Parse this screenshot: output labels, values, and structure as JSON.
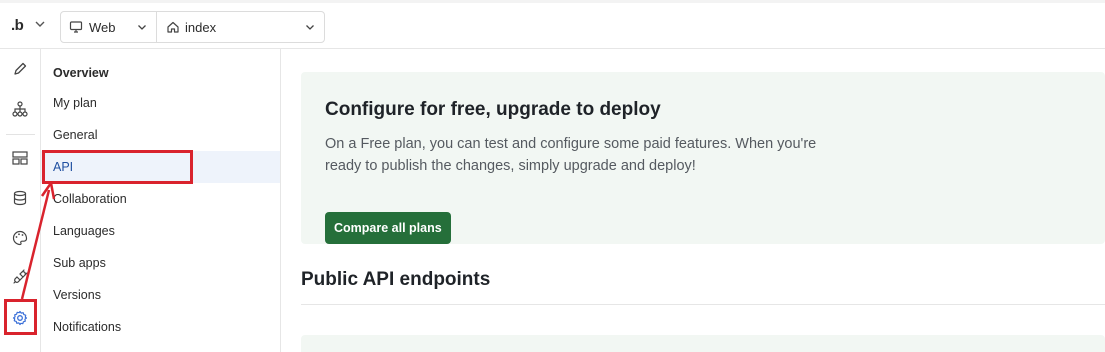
{
  "topbar": {
    "logo": ".b",
    "platform_select": {
      "value": "Web",
      "icon": "monitor-icon"
    },
    "page_select": {
      "value": "index",
      "icon": "home-icon"
    }
  },
  "rail": {
    "icons": [
      "pencil-icon",
      "workflow-icon",
      "layout-icon",
      "database-icon",
      "palette-icon",
      "plug-icon",
      "gear-icon"
    ],
    "active": "gear-icon"
  },
  "nav": {
    "items": [
      {
        "label": "Overview"
      },
      {
        "label": "My plan"
      },
      {
        "label": "General"
      },
      {
        "label": "API"
      },
      {
        "label": "Collaboration"
      },
      {
        "label": "Languages"
      },
      {
        "label": "Sub apps"
      },
      {
        "label": "Versions"
      },
      {
        "label": "Notifications"
      }
    ],
    "active": "API"
  },
  "main": {
    "banner": {
      "title": "Configure for free, upgrade to deploy",
      "text": "On a Free plan, you can test and configure some paid features. When you're ready to publish the changes, simply upgrade and deploy!",
      "button": "Compare all plans"
    },
    "section_title": "Public API endpoints"
  },
  "colors": {
    "highlight": "#d9232d",
    "primary_button": "#256f3a",
    "banner_bg": "#f2f7f3",
    "active_nav_bg": "#eef3fb"
  }
}
